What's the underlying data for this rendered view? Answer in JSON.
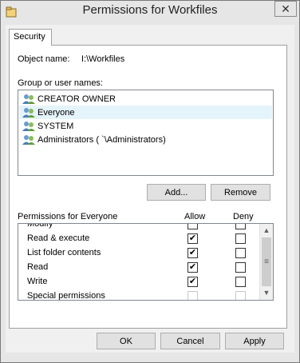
{
  "window": {
    "title": "Permissions for Workfiles",
    "close_glyph": "✕"
  },
  "tabs": [
    {
      "label": "Security"
    }
  ],
  "object": {
    "label": "Object name:",
    "value": "I:\\Workfiles"
  },
  "groups": {
    "label": "Group or user names:",
    "items": [
      {
        "name": "CREATOR OWNER",
        "selected": false
      },
      {
        "name": "Everyone",
        "selected": true
      },
      {
        "name": "SYSTEM",
        "selected": false
      },
      {
        "name": "Administrators (                    `\\Administrators)",
        "selected": false
      }
    ]
  },
  "buttons": {
    "add": "Add...",
    "remove": "Remove",
    "ok": "OK",
    "cancel": "Cancel",
    "apply": "Apply"
  },
  "permissions": {
    "label": "Permissions for Everyone",
    "allow_header": "Allow",
    "deny_header": "Deny",
    "rows": [
      {
        "name": "Modify",
        "allow": false,
        "deny": false,
        "disabled": false
      },
      {
        "name": "Read & execute",
        "allow": true,
        "deny": false,
        "disabled": false
      },
      {
        "name": "List folder contents",
        "allow": true,
        "deny": false,
        "disabled": false
      },
      {
        "name": "Read",
        "allow": true,
        "deny": false,
        "disabled": false
      },
      {
        "name": "Write",
        "allow": true,
        "deny": false,
        "disabled": false
      },
      {
        "name": "Special permissions",
        "allow": false,
        "deny": false,
        "disabled": true
      }
    ]
  },
  "icons": {
    "app": "folder-security-icon",
    "user": "user-group-icon",
    "check": "✔",
    "scroll_up": "▲",
    "scroll_down": "▼",
    "scroll_grip": "≡"
  },
  "colors": {
    "selection": "#e5f3fb",
    "button": "#e1e1e1",
    "window": "#e6e6e6"
  }
}
